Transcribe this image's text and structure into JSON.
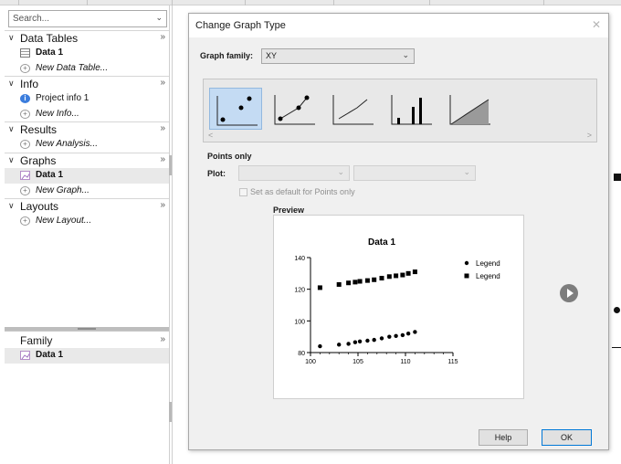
{
  "navigator": {
    "search_placeholder": "Search...",
    "sections": [
      {
        "title": "Data Tables",
        "items": [
          {
            "label": "Data 1"
          },
          {
            "label": "New Data Table..."
          }
        ]
      },
      {
        "title": "Info",
        "items": [
          {
            "label": "Project info 1"
          },
          {
            "label": "New Info..."
          }
        ]
      },
      {
        "title": "Results",
        "items": [
          {
            "label": "New Analysis..."
          }
        ]
      },
      {
        "title": "Graphs",
        "items": [
          {
            "label": "Data 1"
          },
          {
            "label": "New Graph..."
          }
        ]
      },
      {
        "title": "Layouts",
        "items": [
          {
            "label": "New Layout..."
          }
        ]
      }
    ],
    "family": {
      "title": "Family",
      "items": [
        {
          "label": "Data 1"
        }
      ]
    }
  },
  "dialog": {
    "title": "Change Graph Type",
    "graph_family_label": "Graph family:",
    "graph_family_value": "XY",
    "gallery": [
      "points-only-thumbnail",
      "points-and-connecting-line-thumbnail",
      "line-only-thumbnail",
      "spikes-thumbnail",
      "area-fill-thumbnail"
    ],
    "selected_subtype": "Points only",
    "plot_label": "Plot:",
    "set_default_label": "Set as default for Points only",
    "preview_label": "Preview",
    "help_label": "Help",
    "ok_label": "OK"
  },
  "chart_data": {
    "type": "scatter",
    "title": "Data 1",
    "xlim": [
      100,
      115
    ],
    "ylim": [
      80,
      140
    ],
    "x_ticks": [
      100,
      105,
      110,
      115
    ],
    "y_ticks": [
      80,
      100,
      120,
      140
    ],
    "legend_position": "top-right",
    "series": [
      {
        "name": "Legend",
        "marker": "circle",
        "x": [
          101,
          103,
          104,
          104.7,
          105.2,
          106,
          106.7,
          107.5,
          108.3,
          109,
          109.7,
          110.3,
          111
        ],
        "y": [
          84,
          85,
          85.5,
          86.5,
          87,
          87.5,
          88,
          89,
          90,
          90.5,
          91,
          92,
          93
        ]
      },
      {
        "name": "Legend",
        "marker": "square",
        "x": [
          101,
          103,
          104,
          104.7,
          105.2,
          106,
          106.7,
          107.5,
          108.3,
          109,
          109.7,
          110.3,
          111
        ],
        "y": [
          121,
          123,
          124,
          124.5,
          125,
          125.5,
          126,
          127,
          128,
          128.5,
          129,
          130,
          131
        ]
      }
    ]
  }
}
